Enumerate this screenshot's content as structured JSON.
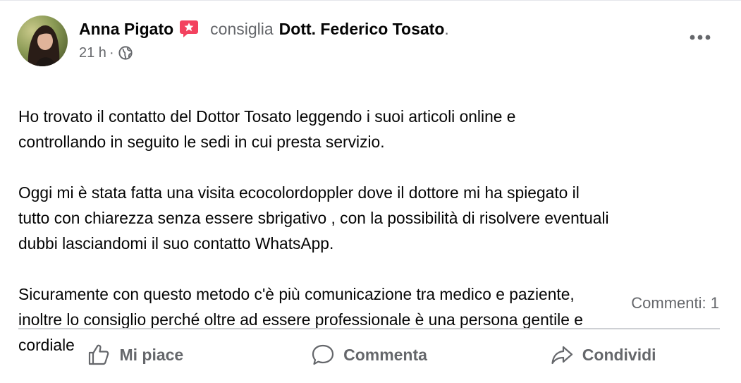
{
  "post": {
    "author": "Anna Pigato",
    "recommend_verb": "consiglia",
    "target_page": "Dott. Federico Tosato",
    "target_suffix": ".",
    "time": "21 h",
    "separator": "·",
    "audience_icon": "globe-icon",
    "badge_icon": "recommend-star-icon",
    "more_icon": "more-options-icon",
    "paragraphs": [
      "Ho trovato il contatto del Dottor Tosato leggendo i suoi articoli online e\ncontrollando in seguito le sedi in cui presta servizio.",
      "Oggi mi è stata fatta una visita  ecocolordoppler dove il dottore mi ha spiegato il\ntutto con chiarezza senza essere sbrigativo , con la possibilità di risolvere eventuali\ndubbi lasciandomi il suo contatto WhatsApp.",
      "Sicuramente con questo metodo c'è più comunicazione tra medico e paziente,\ninoltre lo consiglio perché oltre ad essere professionale è una persona gentile e\ncordiale"
    ],
    "comments_count": "Commenti: 1"
  },
  "actions": {
    "like_label": "Mi piace",
    "like_icon": "thumbs-up-icon",
    "comment_label": "Commenta",
    "comment_icon": "comment-bubble-icon",
    "share_label": "Condividi",
    "share_icon": "share-arrow-icon"
  },
  "colors": {
    "text": "#050505",
    "secondary": "#65676b",
    "badge": "#f3425f",
    "divider": "#ced0d4"
  }
}
